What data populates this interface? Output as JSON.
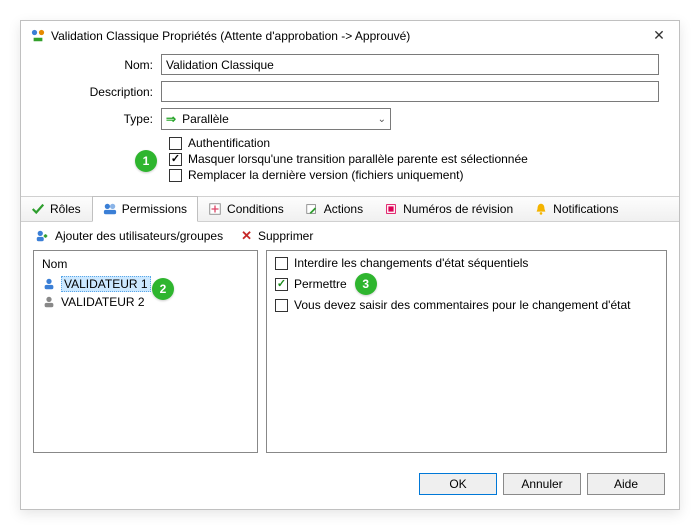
{
  "title": "Validation Classique Propriétés (Attente d'approbation -> Approuvé)",
  "form": {
    "name_label": "Nom:",
    "name_value": "Validation Classique",
    "description_label": "Description:",
    "description_value": "",
    "type_label": "Type:",
    "type_value": "Parallèle",
    "auth_label": "Authentification",
    "mask_label": "Masquer lorsqu'une transition parallèle parente est sélectionnée",
    "replace_label": "Remplacer la dernière version (fichiers uniquement)"
  },
  "tabs": {
    "roles": "Rôles",
    "permissions": "Permissions",
    "conditions": "Conditions",
    "actions": "Actions",
    "revisions": "Numéros de révision",
    "notifications": "Notifications"
  },
  "toolbar": {
    "add": "Ajouter des utilisateurs/groupes",
    "delete": "Supprimer"
  },
  "userlist": {
    "header": "Nom",
    "items": [
      {
        "label": "VALIDATEUR 1"
      },
      {
        "label": "VALIDATEUR 2"
      }
    ]
  },
  "perms": {
    "deny_seq": "Interdire les changements d'état séquentiels",
    "allow": "Permettre",
    "must_comment": "Vous devez saisir des commentaires pour le changement d'état"
  },
  "buttons": {
    "ok": "OK",
    "cancel": "Annuler",
    "help": "Aide"
  },
  "callouts": {
    "c1": "1",
    "c2": "2",
    "c3": "3"
  }
}
